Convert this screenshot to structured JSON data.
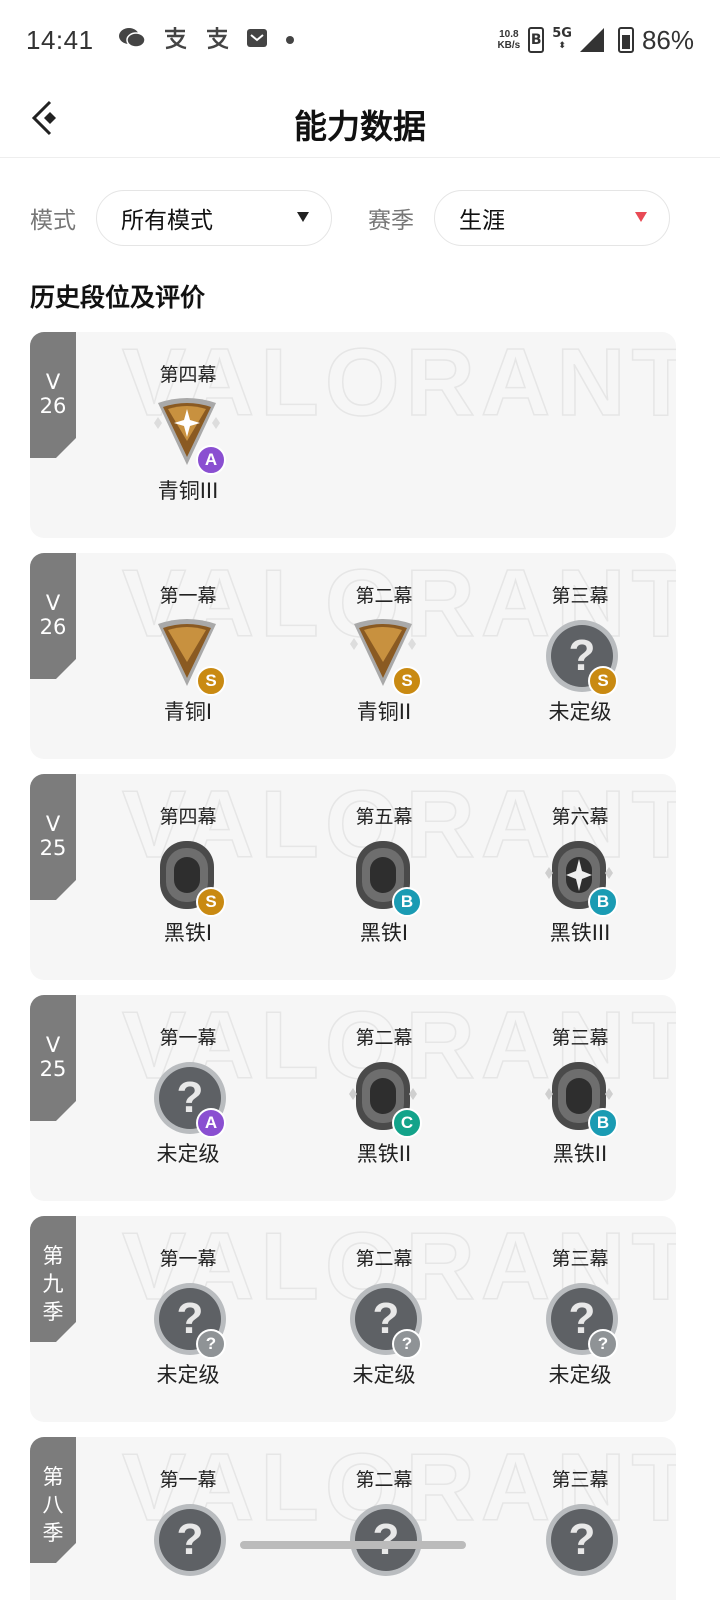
{
  "status_bar": {
    "time": "14:41",
    "net_speed_top": "10.8",
    "net_speed_bottom": "KB/s",
    "sim": "B",
    "network": "5G",
    "battery": "86%",
    "notification_icons": [
      "wechat-icon",
      "alipay-icon",
      "alipay-icon",
      "mail-icon",
      "dot-icon"
    ]
  },
  "header": {
    "title": "能力数据"
  },
  "filters": {
    "mode_label": "模式",
    "mode_value": "所有模式",
    "season_label": "赛季",
    "season_value": "生涯"
  },
  "section_title": "历史段位及评价",
  "watermark": "VALORANT",
  "cards": [
    {
      "tag": [
        "V",
        "26"
      ],
      "acts": [
        {
          "act": "第四幕",
          "rank": "青铜III",
          "tier": "bronze3",
          "grade": "A"
        }
      ]
    },
    {
      "tag": [
        "V",
        "26"
      ],
      "acts": [
        {
          "act": "第一幕",
          "rank": "青铜I",
          "tier": "bronze1",
          "grade": "S"
        },
        {
          "act": "第二幕",
          "rank": "青铜II",
          "tier": "bronze2",
          "grade": "S"
        },
        {
          "act": "第三幕",
          "rank": "未定级",
          "tier": "unranked",
          "grade": "S"
        }
      ]
    },
    {
      "tag": [
        "V",
        "25"
      ],
      "acts": [
        {
          "act": "第四幕",
          "rank": "黑铁I",
          "tier": "iron1",
          "grade": "S"
        },
        {
          "act": "第五幕",
          "rank": "黑铁I",
          "tier": "iron1",
          "grade": "B"
        },
        {
          "act": "第六幕",
          "rank": "黑铁III",
          "tier": "iron3",
          "grade": "B"
        }
      ]
    },
    {
      "tag": [
        "V",
        "25"
      ],
      "acts": [
        {
          "act": "第一幕",
          "rank": "未定级",
          "tier": "unranked",
          "grade": "A"
        },
        {
          "act": "第二幕",
          "rank": "黑铁II",
          "tier": "iron2",
          "grade": "C"
        },
        {
          "act": "第三幕",
          "rank": "黑铁II",
          "tier": "iron2",
          "grade": "B"
        }
      ]
    },
    {
      "tag": [
        "第",
        "九",
        "季"
      ],
      "acts": [
        {
          "act": "第一幕",
          "rank": "未定级",
          "tier": "unranked",
          "grade": "?"
        },
        {
          "act": "第二幕",
          "rank": "未定级",
          "tier": "unranked",
          "grade": "?"
        },
        {
          "act": "第三幕",
          "rank": "未定级",
          "tier": "unranked",
          "grade": "?"
        }
      ]
    },
    {
      "tag": [
        "第",
        "八",
        "季"
      ],
      "acts": [
        {
          "act": "第一幕",
          "rank": "",
          "tier": "unranked",
          "grade": ""
        },
        {
          "act": "第二幕",
          "rank": "",
          "tier": "unranked",
          "grade": ""
        },
        {
          "act": "第三幕",
          "rank": "",
          "tier": "unranked",
          "grade": ""
        }
      ]
    }
  ]
}
